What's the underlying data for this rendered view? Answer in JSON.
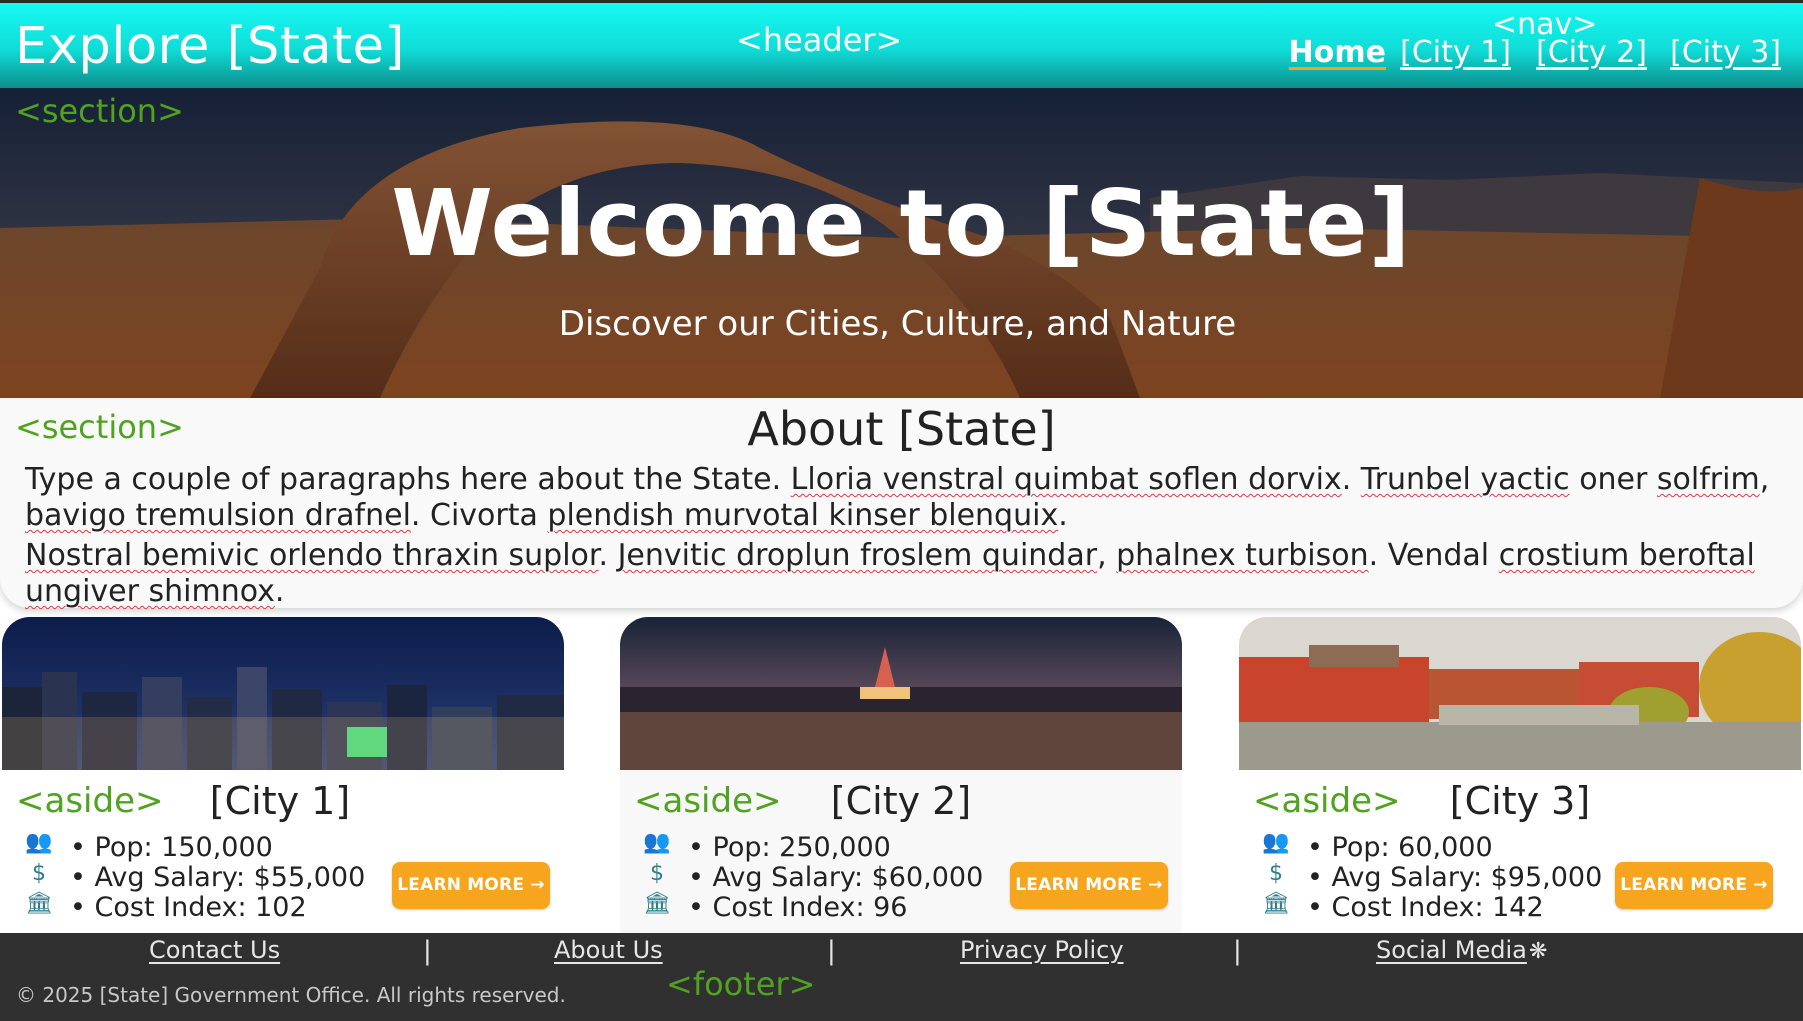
{
  "header": {
    "site_title": "Explore [State]",
    "header_tag": "<header>",
    "nav_tag": "<nav>",
    "nav_items": [
      {
        "label": "Home",
        "active": true
      },
      {
        "label": "[City 1]",
        "active": false
      },
      {
        "label": "[City 2]",
        "active": false
      },
      {
        "label": "[City 3]",
        "active": false
      }
    ]
  },
  "hero": {
    "section_tag": "<section>",
    "title": "Welcome to [State]",
    "subtitle": "Discover our Cities, Culture, and Nature"
  },
  "about": {
    "section_tag": "<section>",
    "title": "About [State]",
    "paragraph1_intro": "Type a couple of paragraphs here about the State.",
    "paragraph1_rest_a": "Lloria venstral quimbat soflen dorvix",
    "paragraph1_rest_b": "Trunbel yactic",
    "paragraph1_rest_c": "oner",
    "paragraph1_rest_d": "solfrim",
    "paragraph1_rest_e": "bavigo tremulsion drafnel",
    "paragraph1_rest_f": "Civorta",
    "paragraph1_rest_g": "plendish murvotal kinser blenquix",
    "paragraph2_a": "Nostral bemivic orlendo thraxin suplor",
    "paragraph2_b": "Jenvitic droplun froslem quindar",
    "paragraph2_c": "phalnex turbison",
    "paragraph2_d": "Vendal",
    "paragraph2_e": "crostium beroftal ungiver shimnox"
  },
  "cities": [
    {
      "tag": "<aside>",
      "name": "[City 1]",
      "pop": "• Pop: 150,000",
      "salary": "• Avg Salary: $55,000",
      "cost": "• Cost Index: 102",
      "button": "LEARN MORE →"
    },
    {
      "tag": "<aside>",
      "name": "[City 2]",
      "pop": "• Pop: 250,000",
      "salary": "• Avg Salary: $60,000",
      "cost": "• Cost Index: 96",
      "button": "LEARN MORE →"
    },
    {
      "tag": "<aside>",
      "name": "[City 3]",
      "pop": "• Pop: 60,000",
      "salary": "• Avg Salary: $95,000",
      "cost": "• Cost Index: 142",
      "button": "LEARN MORE →"
    }
  ],
  "footer": {
    "links": [
      "Contact Us",
      "About Us",
      "Privacy Policy",
      "Social Media"
    ],
    "separator": "|",
    "copyright": "© 2025 [State] Government Office. All rights reserved.",
    "footer_tag": "<footer>"
  },
  "colors": {
    "header_cyan": "#16f9f3",
    "tag_green": "#4fa31e",
    "button_orange": "#f7a51f",
    "footer_dark": "#303030"
  },
  "icons": {
    "population": "people-icon",
    "salary": "dollar-icon",
    "cost": "bank-icon",
    "social": "share-icon"
  }
}
